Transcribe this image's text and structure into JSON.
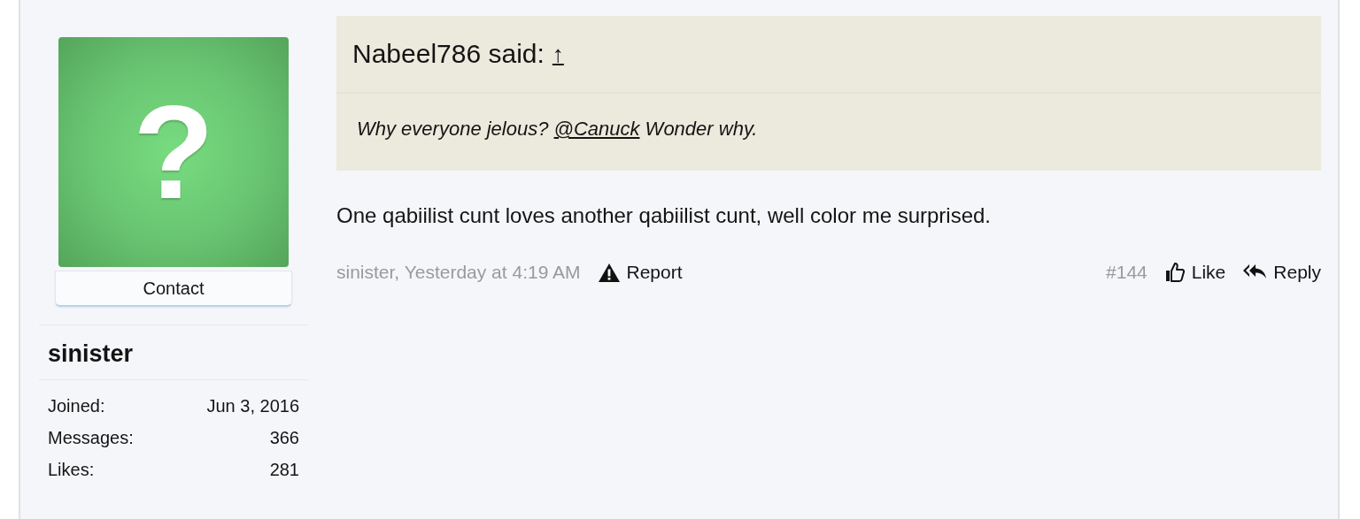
{
  "user": {
    "avatar_glyph": "?",
    "contact_button": "Contact",
    "name": "sinister",
    "stats": [
      {
        "label": "Joined:",
        "value": "Jun 3, 2016"
      },
      {
        "label": "Messages:",
        "value": "366"
      },
      {
        "label": "Likes:",
        "value": "281"
      }
    ]
  },
  "quote": {
    "author_line": "Nabeel786 said:",
    "jump_link": "↑",
    "text_before": "Why everyone jelous?",
    "mention": "@Canuck",
    "text_after": "Wonder why."
  },
  "message": "One qabiilist cunt loves another qabiilist cunt, well color me surprised.",
  "footer": {
    "byline": "sinister, Yesterday at 4:19 AM",
    "report": "Report",
    "post_number": "#144",
    "like": "Like",
    "reply": "Reply"
  }
}
